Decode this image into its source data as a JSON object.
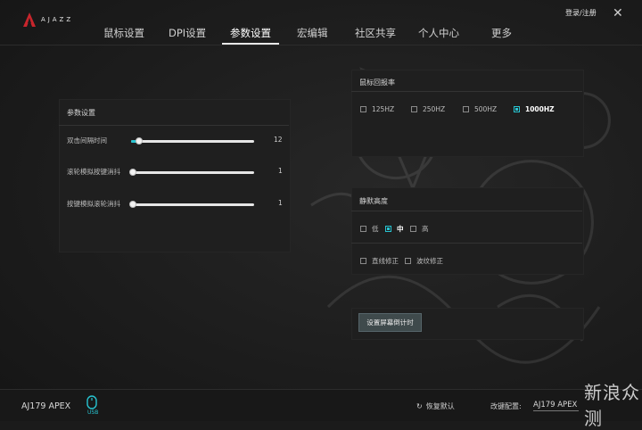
{
  "app": {
    "brand": "AJAZZ",
    "login": "登录/注册",
    "close_icon": "close-icon"
  },
  "nav": {
    "items": [
      "鼠标设置",
      "DPI设置",
      "参数设置",
      "宏编辑",
      "社区共享",
      "个人中心",
      "更多"
    ],
    "active": "参数设置"
  },
  "params": {
    "title": "参数设置",
    "sliders": [
      {
        "label": "双击间隔时间",
        "value": "12",
        "fraction": 0.06
      },
      {
        "label": "滚轮模拟按键消抖",
        "value": "1",
        "fraction": 0.0
      },
      {
        "label": "按键模拟滚轮消抖",
        "value": "1",
        "fraction": 0.0
      }
    ]
  },
  "report_rate": {
    "title": "鼠标回报率",
    "options": [
      {
        "label": "125HZ",
        "checked": false
      },
      {
        "label": "250HZ",
        "checked": false
      },
      {
        "label": "500HZ",
        "checked": false
      },
      {
        "label": "1000HZ",
        "checked": true
      }
    ]
  },
  "silent_height": {
    "title": "静默高度",
    "levels": [
      {
        "label": "低",
        "checked": false
      },
      {
        "label": "中",
        "checked": true
      },
      {
        "label": "高",
        "checked": false
      }
    ],
    "extras": [
      {
        "label": "直线修正",
        "checked": false
      },
      {
        "label": "波纹修正",
        "checked": false
      }
    ]
  },
  "sleep": {
    "button": "设置屏幕倒计时"
  },
  "footer": {
    "device": "AJ179 APEX",
    "usb": "USB",
    "restore": "恢复默认",
    "config_label": "改键配置:",
    "config_value": "AJ179 APEX"
  },
  "watermark": "新浪众测",
  "accent": "#27c4d1"
}
